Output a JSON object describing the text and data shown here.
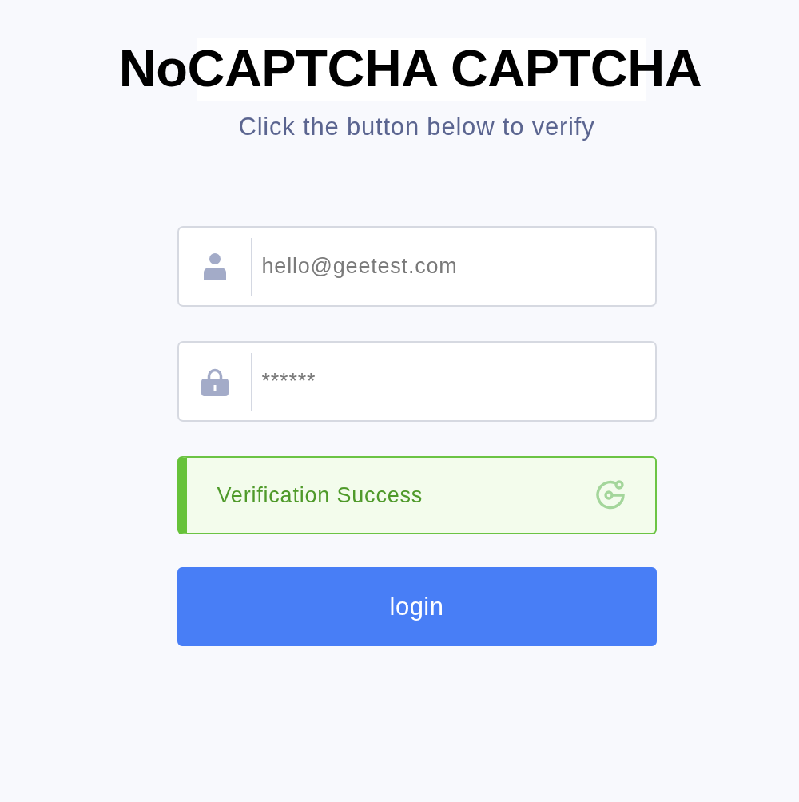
{
  "title": "NoCAPTCHA CAPTCHA",
  "subtitle": "Click the button below to verify",
  "fields": [
    {
      "kind": "user",
      "placeholder": "hello@geetest.com"
    },
    {
      "kind": "password",
      "placeholder": "******"
    }
  ],
  "verification": {
    "verified": true,
    "label": "Verification Success"
  },
  "login_button": {
    "label": "login"
  }
}
